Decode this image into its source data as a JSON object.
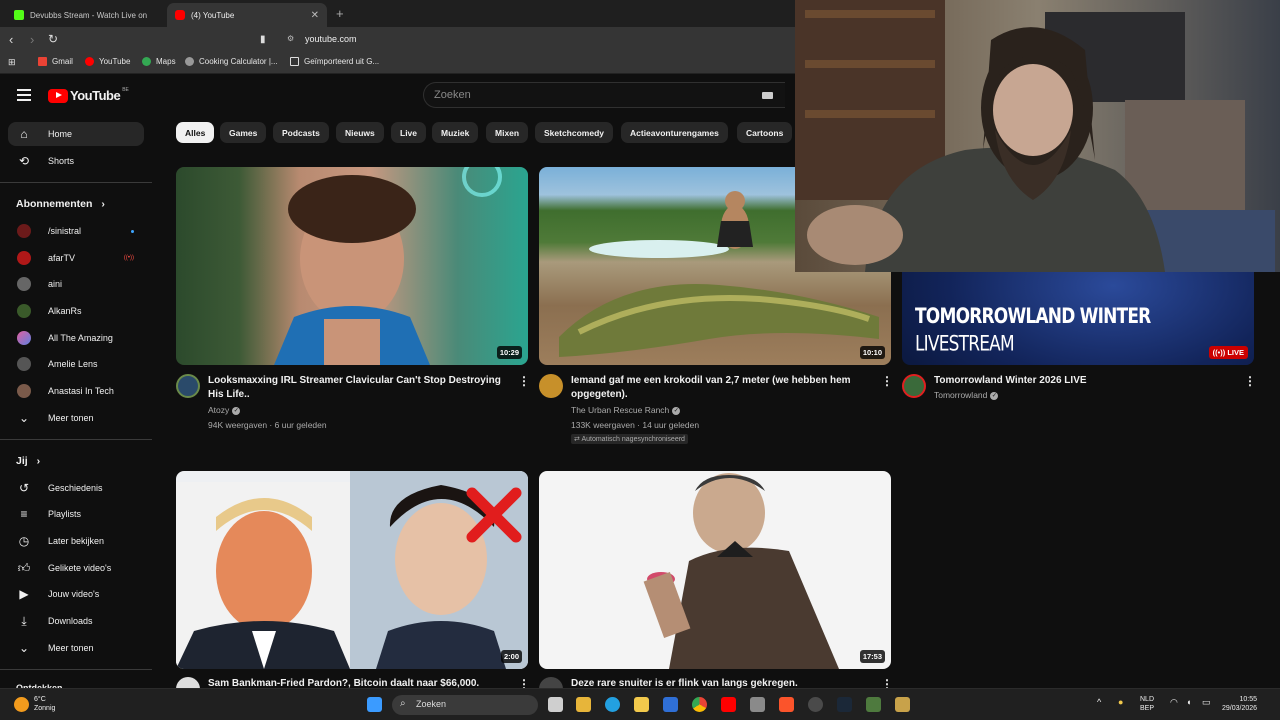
{
  "browser": {
    "tabs": [
      {
        "title": "Devubbs Stream - Watch Live on"
      },
      {
        "title": "(4) YouTube"
      }
    ],
    "url": "youtube.com",
    "bookmarks": [
      "Gmail",
      "YouTube",
      "Maps",
      "Cooking Calculator |...",
      "Geïmporteerd uit G..."
    ]
  },
  "header": {
    "logo": "YouTube",
    "country": "BE",
    "search_placeholder": "Zoeken"
  },
  "sidebar": {
    "home": "Home",
    "shorts": "Shorts",
    "subscriptions_heading": "Abonnementen",
    "subscriptions": [
      {
        "name": "/sinistral",
        "color": "#6b1a1a"
      },
      {
        "name": "afarTV",
        "color": "#b01818"
      },
      {
        "name": "aini",
        "color": "#666666"
      },
      {
        "name": "AlkanRs",
        "color": "#3a5a2a"
      },
      {
        "name": "All The Amazing",
        "color": "#c060c0"
      },
      {
        "name": "Amelie Lens",
        "color": "#555555"
      },
      {
        "name": "Anastasi In Tech",
        "color": "#7a5a4a"
      }
    ],
    "show_more_1": "Meer tonen",
    "you_heading": "Jij",
    "you_items": [
      "Geschiedenis",
      "Playlists",
      "Later bekijken",
      "Gelikete video's",
      "Jouw video's",
      "Downloads"
    ],
    "show_more_2": "Meer tonen",
    "bottom_heading": "Ontdekken"
  },
  "chips": [
    "Alles",
    "Games",
    "Podcasts",
    "Nieuws",
    "Live",
    "Muziek",
    "Mixen",
    "Sketchcomedy",
    "Actieavonturengames",
    "Cartoons"
  ],
  "videos": [
    {
      "title": "Looksmaxxing IRL Streamer Clavicular Can't Stop Destroying His Life..",
      "channel": "Atozy",
      "meta": "94K weergaven · 6 uur geleden",
      "duration": "10:29"
    },
    {
      "title": "Iemand gaf me een krokodil van 2,7 meter (we hebben hem opgegeten).",
      "channel": "The Urban Rescue Ranch",
      "meta": "133K weergaven · 14 uur geleden",
      "badge": "Automatisch nagesynchroniseerd",
      "duration": "10:10"
    },
    {
      "title": "Tomorrowland Winter 2026 LIVE",
      "channel": "Tomorrowland",
      "live": "LIVE",
      "thumb_line1": "TOMORROWLAND WINTER",
      "thumb_line2": "LIVESTREAM"
    },
    {
      "title": "Sam Bankman-Fried Pardon?, Bitcoin daalt naar $66,000.",
      "duration": "2:00"
    },
    {
      "title": "Deze rare snuiter is er flink van langs gekregen.",
      "duration": "17:53"
    }
  ],
  "taskbar": {
    "weather_temp": "6°C",
    "weather_desc": "Zonnig",
    "search": "Zoeken",
    "lang1": "NLD",
    "lang2": "BEP",
    "time": "10:55",
    "date": "29/03/2026"
  }
}
